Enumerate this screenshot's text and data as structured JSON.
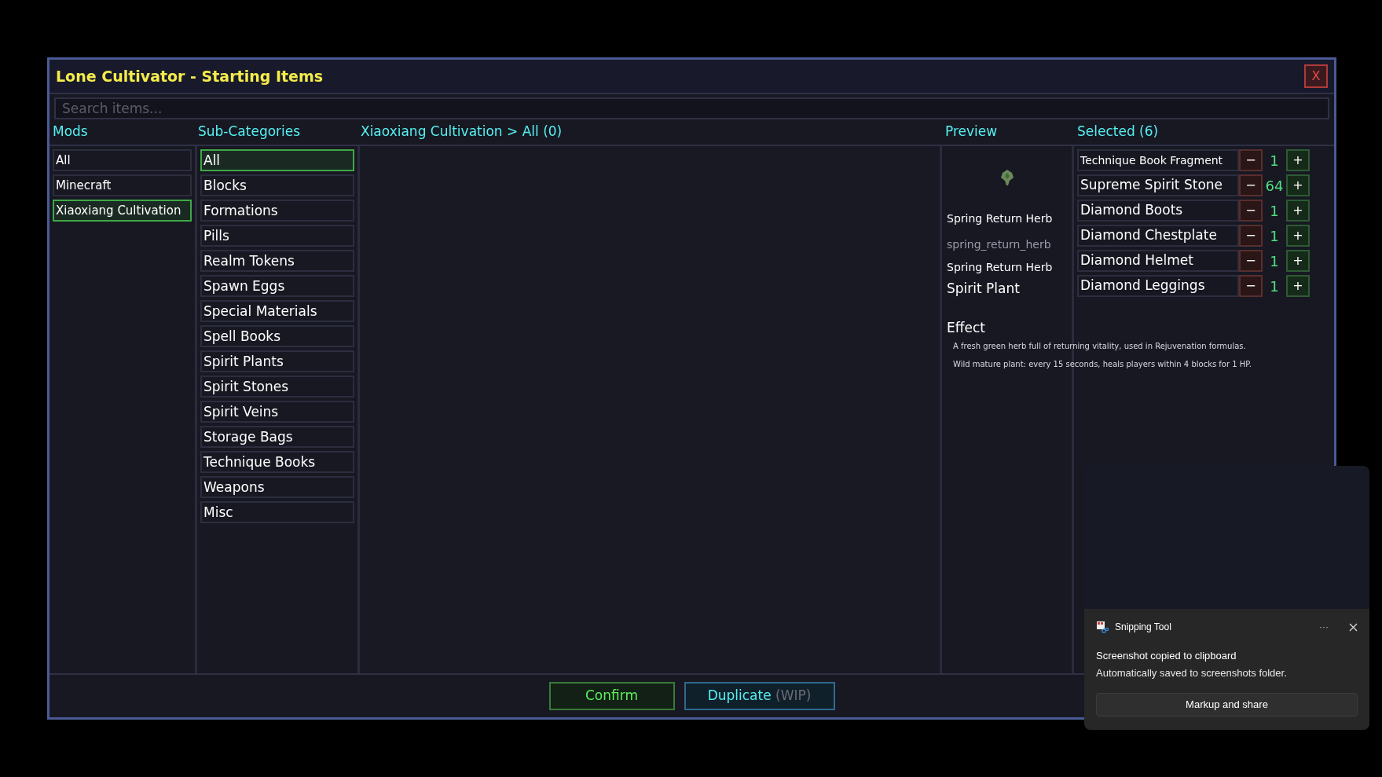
{
  "window": {
    "title": "Lone Cultivator - Starting Items",
    "close_label": "X"
  },
  "search": {
    "placeholder": "Search items..."
  },
  "headers": {
    "mods": "Mods",
    "sub_categories": "Sub-Categories",
    "breadcrumb": "Xiaoxiang Cultivation > All (0)",
    "preview": "Preview",
    "selected": "Selected (6)"
  },
  "mods": [
    {
      "label": "All",
      "selected": false
    },
    {
      "label": "Minecraft",
      "selected": false
    },
    {
      "label": "Xiaoxiang Cultivation",
      "selected": true
    }
  ],
  "sub_categories": [
    {
      "label": "All",
      "selected": true
    },
    {
      "label": "Blocks",
      "selected": false
    },
    {
      "label": "Formations",
      "selected": false
    },
    {
      "label": "Pills",
      "selected": false
    },
    {
      "label": "Realm Tokens",
      "selected": false
    },
    {
      "label": "Spawn Eggs",
      "selected": false
    },
    {
      "label": "Special Materials",
      "selected": false
    },
    {
      "label": "Spell Books",
      "selected": false
    },
    {
      "label": "Spirit Plants",
      "selected": false
    },
    {
      "label": "Spirit Stones",
      "selected": false
    },
    {
      "label": "Spirit Veins",
      "selected": false
    },
    {
      "label": "Storage Bags",
      "selected": false
    },
    {
      "label": "Technique Books",
      "selected": false
    },
    {
      "label": "Weapons",
      "selected": false
    },
    {
      "label": "Misc",
      "selected": false
    }
  ],
  "preview": {
    "name": "Spring Return Herb",
    "id": "spring_return_herb",
    "display_name": "Spring Return Herb",
    "category": "Spirit Plant",
    "effect_heading": "Effect",
    "effect_lines": [
      "A fresh green herb full of returning vitality, used in Rejuvenation formulas.",
      "Wild mature plant: every 15 seconds, heals players within 4 blocks for 1 HP."
    ]
  },
  "selected_items": [
    {
      "name": "Technique Book Fragment",
      "count": "1",
      "minus": "−",
      "plus": "+"
    },
    {
      "name": "Supreme Spirit Stone",
      "count": "64",
      "minus": "−",
      "plus": "+"
    },
    {
      "name": "Diamond Boots",
      "count": "1",
      "minus": "−",
      "plus": "+"
    },
    {
      "name": "Diamond Chestplate",
      "count": "1",
      "minus": "−",
      "plus": "+"
    },
    {
      "name": "Diamond Helmet",
      "count": "1",
      "minus": "−",
      "plus": "+"
    },
    {
      "name": "Diamond Leggings",
      "count": "1",
      "minus": "−",
      "plus": "+"
    }
  ],
  "buttons": {
    "confirm": "Confirm",
    "duplicate": "Duplicate",
    "duplicate_suffix": "(WIP)"
  },
  "notification": {
    "app": "Snipping Tool",
    "more": "···",
    "title": "Screenshot copied to clipboard",
    "body": "Automatically saved to screenshots folder.",
    "action": "Markup and share"
  }
}
